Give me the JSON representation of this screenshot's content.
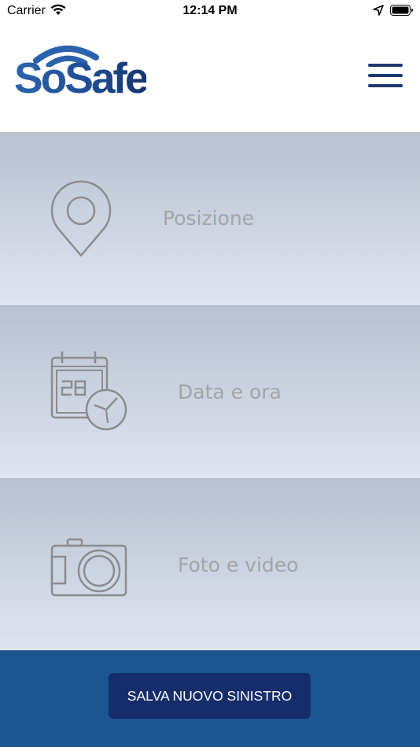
{
  "status_bar": {
    "carrier": "Carrier",
    "time": "12:14 PM",
    "icons": [
      "wifi-icon",
      "location-arrow-icon",
      "battery-icon"
    ]
  },
  "header": {
    "logo_text": "SoSafe",
    "menu_icon": "hamburger-menu-icon"
  },
  "options": [
    {
      "label": "Posizione",
      "icon": "map-pin-icon"
    },
    {
      "label": "Data e ora",
      "icon": "calendar-clock-icon"
    },
    {
      "label": "Foto e video",
      "icon": "camera-icon"
    }
  ],
  "footer": {
    "save_label": "SALVA NUOVO SINISTRO"
  },
  "colors": {
    "brand_blue": "#1c5591",
    "button_navy": "#152d6b",
    "menu_navy": "#1c3a70",
    "label_gray": "#a5a5a5"
  }
}
